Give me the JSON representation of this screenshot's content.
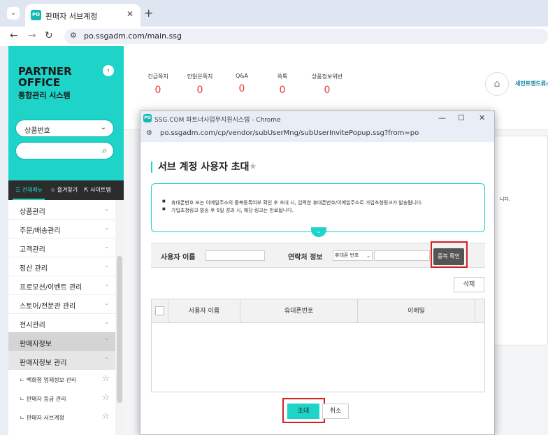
{
  "browser": {
    "tab_title": "판매자 서브계정",
    "favicon_text": "PO",
    "url": "po.ssgadm.com/main.ssg"
  },
  "sidebar": {
    "logo_line1": "PARTNER",
    "logo_line2": "OFFICE",
    "logo_sub": "통합관리 시스템",
    "search_type": "상품번호",
    "menu_tabs": [
      "☰ 전체메뉴",
      "☆ 즐겨찾기",
      "⇱ 사이트맵"
    ],
    "items": [
      {
        "label": "상품관리"
      },
      {
        "label": "주문/배송관리"
      },
      {
        "label": "고객관리"
      },
      {
        "label": "정산 관리"
      },
      {
        "label": "프로모션/이벤트 관리"
      },
      {
        "label": "스토어/전문관 관리"
      },
      {
        "label": "전시관리"
      },
      {
        "label": "판매자정보"
      },
      {
        "label": "판매자정보 관리"
      }
    ],
    "sub_items": [
      {
        "label": "ㄴ 백화점 업체정보 관리"
      },
      {
        "label": "ㄴ 판매자 등급 관리"
      },
      {
        "label": "ㄴ 판매자 서브계정"
      }
    ]
  },
  "stats": [
    {
      "label": "긴급쪽지",
      "value": "0"
    },
    {
      "label": "안읽은쪽지",
      "value": "0"
    },
    {
      "label": "Q&A",
      "value": "0"
    },
    {
      "label": "쓱톡",
      "value": "0"
    },
    {
      "label": "상품정보위반",
      "value": "0"
    }
  ],
  "store_name": "세인트앤드류스",
  "main_panel_text": "니다.",
  "popup": {
    "title": "SSG.COM 파트너사업무지원시스템 - Chrome",
    "url": "po.ssgadm.com/cp/vendor/subUserMng/subUserInvitePopup.ssg?from=po",
    "heading": "서브 계정 사용자 초대",
    "notice": [
      "휴대폰번호 또는 이메일주소의 중복등록여부 확인 후 초대 시, 입력한 휴대폰번호/이메일주소로 가입초청링크가 발송됩니다.",
      "가입초청링크 발송 후 5일 경과 시, 해당 링크는 만료됩니다."
    ],
    "user_name_label": "사용자 이름",
    "contact_label": "연락처 정보",
    "contact_type": "휴대폰 번호",
    "dup_check_label": "중복 확인",
    "delete_label": "삭제",
    "table_headers": [
      "사용자 이름",
      "휴대폰번호",
      "이메일"
    ],
    "invite_label": "초대",
    "cancel_label": "취소"
  },
  "colors": {
    "accent": "#1ed3c8",
    "highlight": "#d92020",
    "alert_value": "#e53935"
  }
}
